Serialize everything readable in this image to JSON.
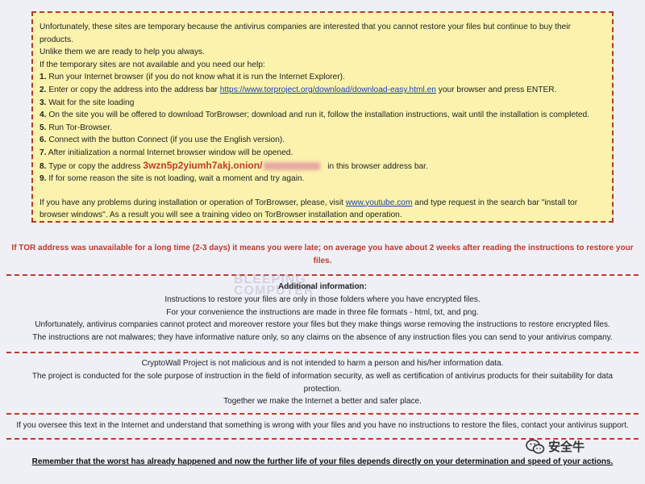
{
  "notice": {
    "intro_line1": "Unfortunately, these sites are temporary because the antivirus companies are interested that you cannot restore your files but continue to buy their products.",
    "intro_line2": "Unlike them we are ready to help you always.",
    "intro_line3": "If the temporary sites are not available and you need our help:",
    "steps": [
      {
        "num": "1.",
        "text": "Run your Internet browser (if you do not know what it is run the Internet Explorer)."
      },
      {
        "num": "2.",
        "pre": "Enter or copy the address into the address bar ",
        "link": "https://www.torproject.org/download/download-easy.html.en",
        "post": " your browser and press ENTER."
      },
      {
        "num": "3.",
        "text": "Wait for the site loading"
      },
      {
        "num": "4.",
        "text": "On the site you will be offered to download TorBrowser; download and run it, follow the installation instructions, wait until the installation is completed."
      },
      {
        "num": "5.",
        "text": "Run Tor-Browser."
      },
      {
        "num": "6.",
        "text": "Connect with the button Connect (if you use the English version)."
      },
      {
        "num": "7.",
        "text": "After initialization a normal Internet browser window will be opened."
      },
      {
        "num": "8.",
        "pre": "Type or copy the address ",
        "address": "3wzn5p2yiumh7akj.onion/",
        "post": " in this browser address bar."
      },
      {
        "num": "9.",
        "text": "If for some reason the site is not loading, wait a moment and try again."
      }
    ],
    "help_pre": "If you have any problems during installation or operation of TorBrowser, please, visit ",
    "help_link": "www.youtube.com",
    "help_post": " and type request in the search bar \"install tor browser windows\". As a result you will see a training video on TorBrowser installation and operation."
  },
  "warning": "If TOR address was unavailable for a long time (2-3 days) it means you were late; on average you have about 2 weeks after reading the instructions to restore your files.",
  "additional": {
    "heading": "Additional information:",
    "lines": [
      "Instructions to restore your files are only in those folders where you have encrypted files.",
      "For your convenience the instructions are made in three file formats - html, txt, and png.",
      "Unfortunately, antivirus companies cannot protect and moreover restore your files but they make things worse removing the instructions to restore encrypted files.",
      "The instructions are not malwares; they have informative nature only, so any claims on the absence of any instruction files you can send to your antivirus company."
    ]
  },
  "project": {
    "lines": [
      "CryptoWall Project is not malicious and is not intended to harm a person and his/her information data.",
      "The project is conducted for the sole purpose of instruction in the field of information security, as well as certification of antivirus products for their suitability for data protection.",
      "Together we make the Internet a better and safer place."
    ]
  },
  "support": "If you oversee this text in the Internet and understand that something is wrong with your files and you have no instructions to restore the files, contact your antivirus support.",
  "final": "Remember that the worst has already happened and now the further life of your files depends directly on your determination and speed of your actions.",
  "watermark": {
    "line1": "BLEEPING",
    "line2": "COMPUTER"
  },
  "wechat": {
    "label": "安全牛",
    "icon": "wechat-icon"
  },
  "colors": {
    "box_bg": "#fbf3ad",
    "border": "#b03a2e",
    "warning": "#c0392b",
    "link": "#1a3fb0"
  }
}
